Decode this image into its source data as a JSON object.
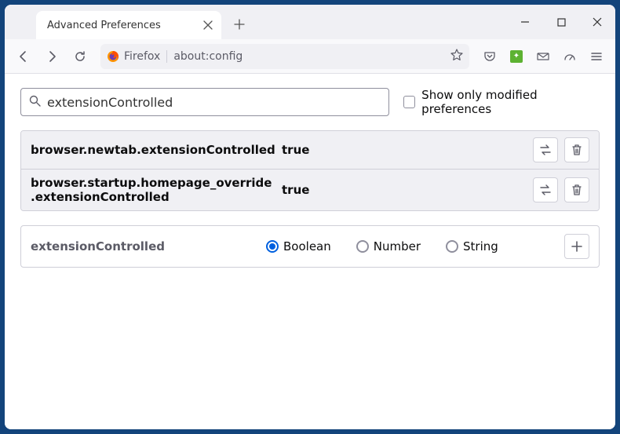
{
  "window": {
    "tab_title": "Advanced Preferences"
  },
  "toolbar": {
    "identity": "Firefox",
    "url": "about:config"
  },
  "search": {
    "value": "extensionControlled",
    "modified_only_label": "Show only modified preferences"
  },
  "prefs": [
    {
      "name": "browser.newtab.extensionControlled",
      "value": "true"
    },
    {
      "name": "browser.startup.homepage_override.extensionControlled",
      "value": "true"
    }
  ],
  "new_pref": {
    "name": "extensionControlled",
    "types": {
      "boolean": "Boolean",
      "number": "Number",
      "string": "String"
    },
    "selected": "boolean"
  }
}
